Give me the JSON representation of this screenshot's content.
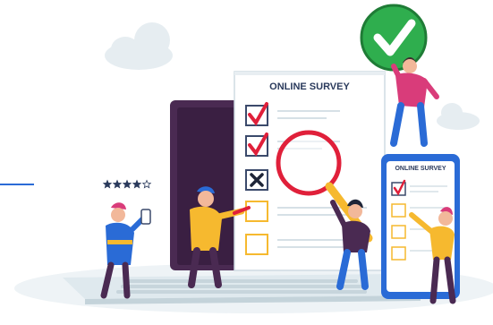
{
  "illustration": {
    "main_form": {
      "title": "ONLINE SURVEY",
      "checkbox_states": [
        "checked",
        "checked",
        "crossed",
        "empty",
        "empty"
      ]
    },
    "phone_form": {
      "title": "ONLINE SURVEY",
      "checkbox_states": [
        "checked",
        "empty",
        "empty",
        "empty"
      ]
    },
    "rating": {
      "stars_filled": 4,
      "stars_total": 5
    },
    "badge_icon": "check-icon"
  },
  "colors": {
    "laptop_screen": "#4a2a52",
    "keyboard": "#dfe9ee",
    "paper": "#ffffff",
    "check_green": "#2fae4e",
    "mark_red": "#e0203a",
    "cloud": "#e6edf1",
    "accent_blue": "#2a6bd6",
    "shirt_yellow": "#f6b92f",
    "shirt_pink": "#d93c7a"
  }
}
